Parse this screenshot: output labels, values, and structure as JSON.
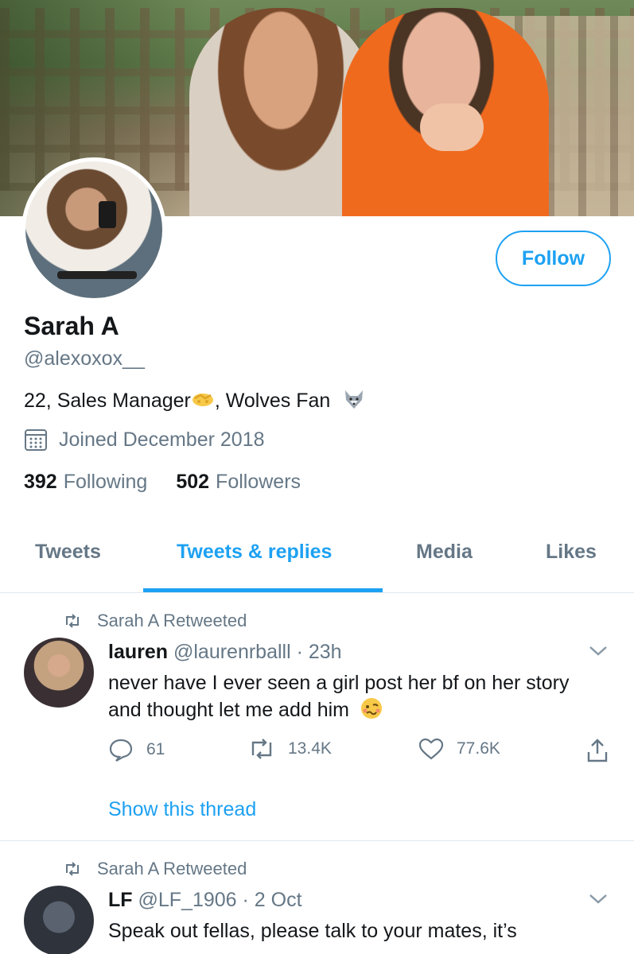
{
  "profile": {
    "name": "Sarah A",
    "handle": "@alexoxox__",
    "bio_prefix": "22, Sales Manager",
    "bio_suffix": ", Wolves Fan",
    "joined": "Joined December 2018",
    "following_count": "392",
    "following_label": "Following",
    "followers_count": "502",
    "followers_label": "Followers",
    "follow_button": "Follow"
  },
  "tabs": [
    {
      "label": "Tweets",
      "active": false
    },
    {
      "label": "Tweets & replies",
      "active": true
    },
    {
      "label": "Media",
      "active": false
    },
    {
      "label": "Likes",
      "active": false
    }
  ],
  "tweets": [
    {
      "retweeted_by": "Sarah A Retweeted",
      "name": "lauren",
      "meta": "@laurenrballl · 23h",
      "text": "never have I ever seen a girl post her bf on her story and thought let me add him",
      "replies": "61",
      "retweets": "13.4K",
      "likes": "77.6K",
      "show_thread": "Show this thread"
    },
    {
      "retweeted_by": "Sarah A Retweeted",
      "name": "LF",
      "meta": "@LF_1906 · 2 Oct",
      "text": "Speak out fellas, please talk to your mates, it’s"
    }
  ],
  "colors": {
    "accent": "#1da1f2",
    "secondary_text": "#657786",
    "primary_text": "#14171a",
    "divider": "#e1e8ed"
  },
  "icons": [
    "calendar-icon",
    "handshake-emoji",
    "wolf-emoji",
    "retweet-icon",
    "chevron-down-icon",
    "reply-icon",
    "heart-icon",
    "share-icon",
    "woozy-face-emoji"
  ]
}
